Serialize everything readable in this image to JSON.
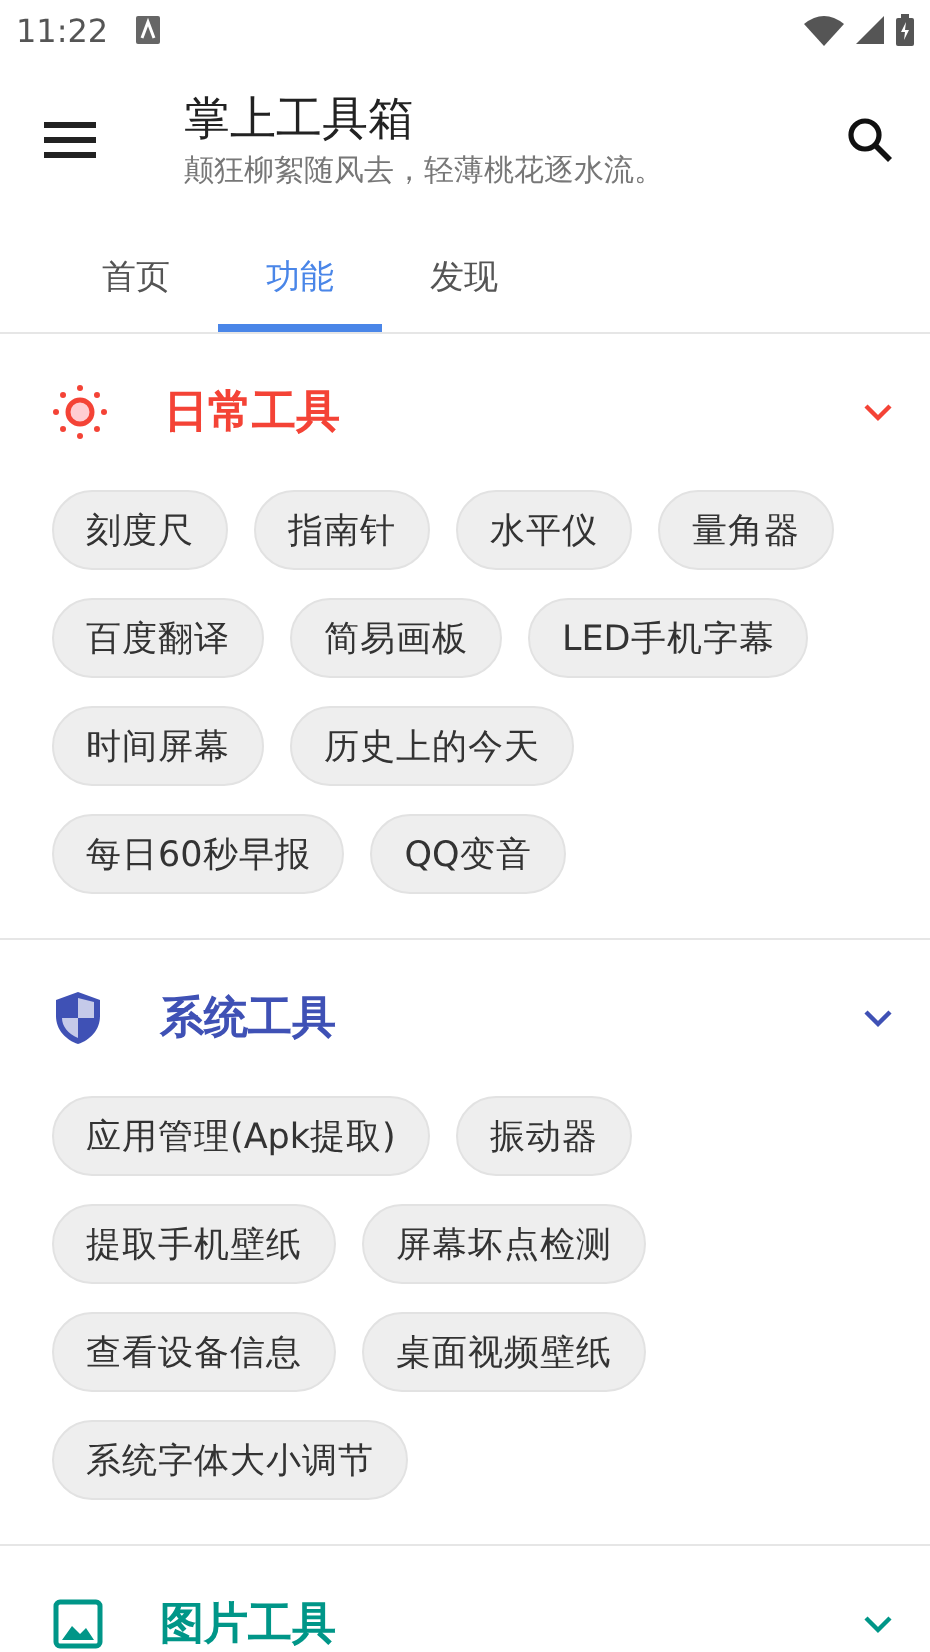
{
  "status_bar": {
    "time": "11:22"
  },
  "app_bar": {
    "title": "掌上工具箱",
    "subtitle": "颠狂柳絮随风去，轻薄桃花逐水流。"
  },
  "tabs": [
    {
      "label": "首页",
      "selected": false
    },
    {
      "label": "功能",
      "selected": true
    },
    {
      "label": "发现",
      "selected": false
    }
  ],
  "sections": [
    {
      "title": "日常工具",
      "kind": "sun",
      "color": "#f44336",
      "tools": [
        "刻度尺",
        "指南针",
        "水平仪",
        "量角器",
        "百度翻译",
        "简易画板",
        "LED手机字幕",
        "时间屏幕",
        "历史上的今天",
        "每日60秒早报",
        "QQ变音"
      ]
    },
    {
      "title": "系统工具",
      "kind": "shield",
      "color": "#3f51b5",
      "tools": [
        "应用管理(Apk提取)",
        "振动器",
        "提取手机壁纸",
        "屏幕坏点检测",
        "查看设备信息",
        "桌面视频壁纸",
        "系统字体大小调节"
      ]
    },
    {
      "title": "图片工具",
      "kind": "image",
      "color": "#009688"
    }
  ]
}
